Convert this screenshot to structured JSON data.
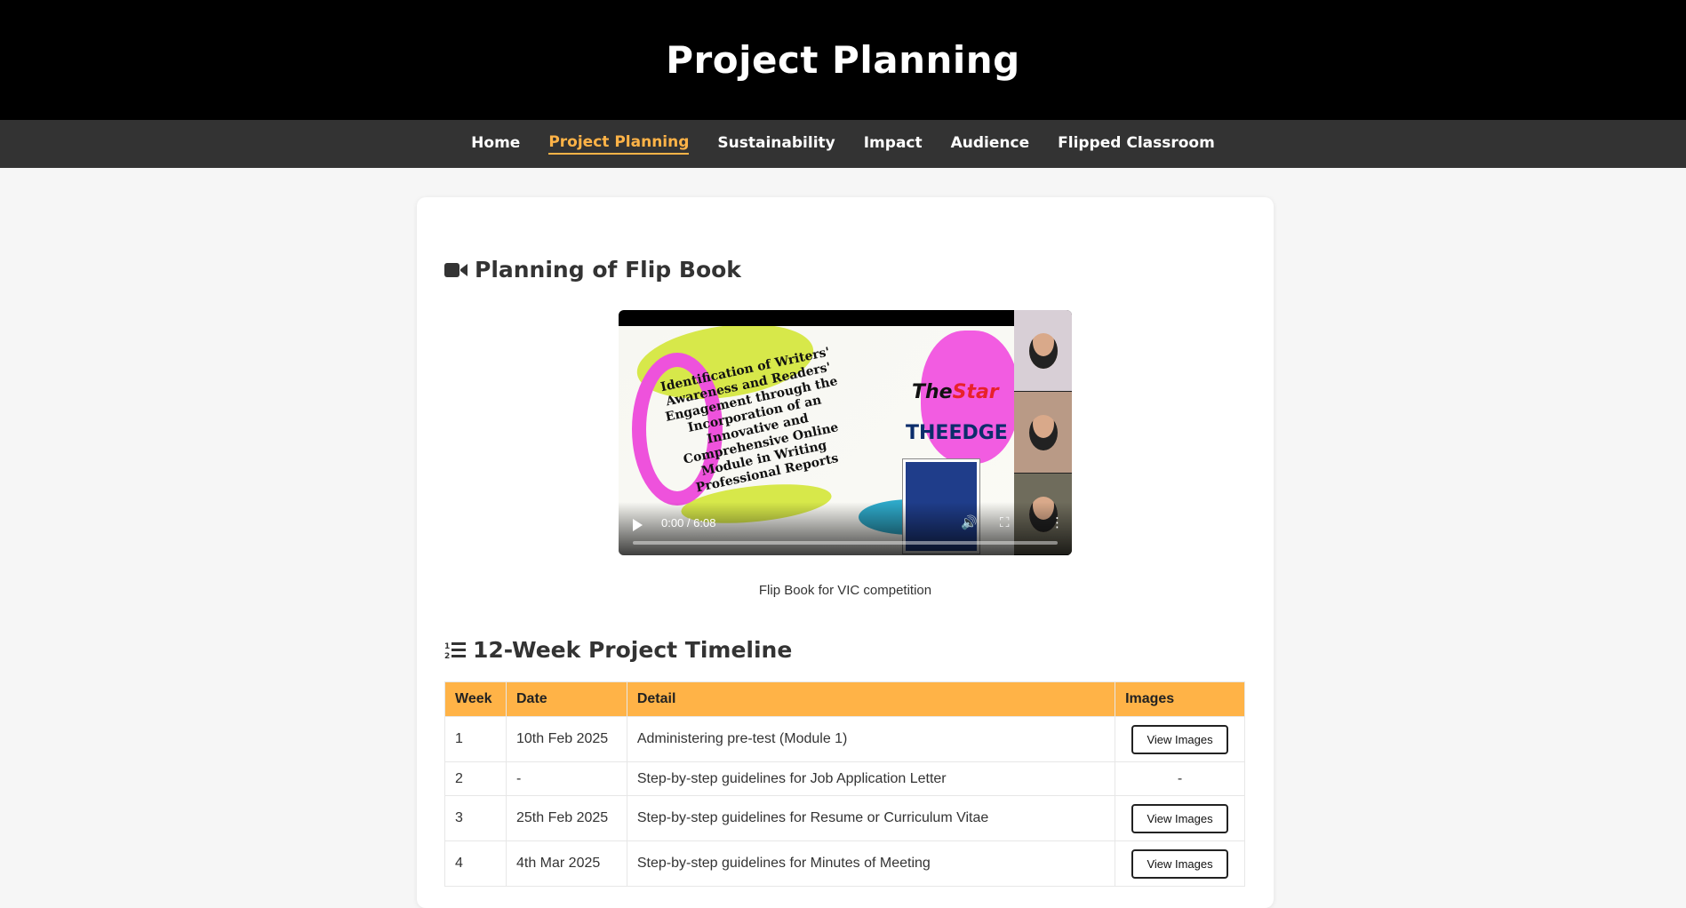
{
  "header": {
    "title": "Project Planning"
  },
  "nav": {
    "items": [
      "Home",
      "Project Planning",
      "Sustainability",
      "Impact",
      "Audience",
      "Flipped Classroom"
    ],
    "active": "Project Planning"
  },
  "video_section": {
    "icon": "video-camera-icon",
    "title": "Planning of Flip Book",
    "video": {
      "slide_title": "Identification of Writers' Awareness and Readers' Engagement through the Incorporation of an Innovative and Comprehensive Online Module in Writing Professional Reports",
      "logo_star_prefix": "The",
      "logo_star_name": "Star",
      "logo_edge": "THEEDGE",
      "time": "0:00 / 6:08",
      "progress": 0
    },
    "caption": "Flip Book for VIC competition"
  },
  "timeline_section": {
    "icon": "ordered-list-icon",
    "title": "12-Week Project Timeline",
    "columns": [
      "Week",
      "Date",
      "Detail",
      "Images"
    ],
    "rows": [
      {
        "week": "1",
        "date": "10th Feb 2025",
        "detail": "Administering pre-test (Module 1)",
        "images": "View Images"
      },
      {
        "week": "2",
        "date": "-",
        "detail": "Step-by-step guidelines for Job Application Letter",
        "images": "-"
      },
      {
        "week": "3",
        "date": "25th Feb 2025",
        "detail": "Step-by-step guidelines for Resume or Curriculum Vitae",
        "images": "View Images"
      },
      {
        "week": "4",
        "date": "4th Mar 2025",
        "detail": "Step-by-step guidelines for Minutes of Meeting",
        "images": "View Images"
      }
    ]
  },
  "colors": {
    "accent": "#ffb347",
    "header_bg": "#000000",
    "nav_bg": "#333333"
  }
}
